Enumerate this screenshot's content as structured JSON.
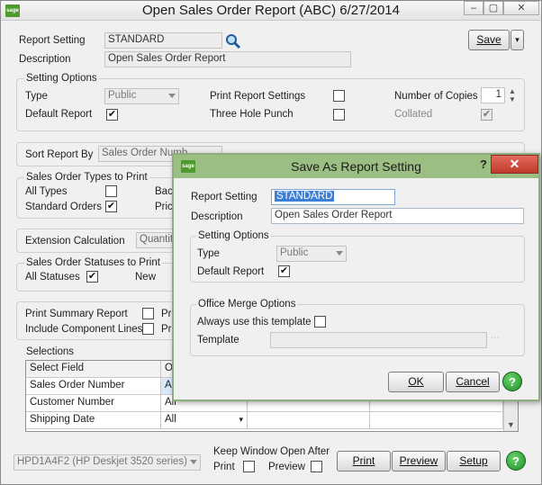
{
  "window": {
    "title": "Open Sales Order Report (ABC) 6/27/2014",
    "logo": "sage"
  },
  "main": {
    "report_setting_label": "Report Setting",
    "report_setting_value": "STANDARD",
    "description_label": "Description",
    "description_value": "Open Sales Order Report",
    "save_label": "Save",
    "setting_options": {
      "title": "Setting Options",
      "type_label": "Type",
      "type_value": "Public",
      "default_report_label": "Default Report",
      "default_report_checked": "✔",
      "print_report_settings_label": "Print Report Settings",
      "three_hole_punch_label": "Three Hole Punch",
      "copies_label": "Number of Copies",
      "copies_value": "1",
      "collated_label": "Collated",
      "collated_checked": "✔"
    },
    "sort_report_by_label": "Sort Report By",
    "sort_report_by_value": "Sales Order Numb",
    "sales_order_types": {
      "title": "Sales Order Types to Print",
      "all_types_label": "All Types",
      "standard_orders_label": "Standard Orders",
      "standard_orders_checked": "✔",
      "back_label": "Bac",
      "price_label": "Pric"
    },
    "extension_calc_label": "Extension Calculation",
    "extension_calc_value": "Quantity",
    "sales_order_statuses": {
      "title": "Sales Order Statuses to Print",
      "all_statuses_label": "All Statuses",
      "all_statuses_checked": "✔",
      "new_label": "New"
    },
    "print_summary_label": "Print Summary Report",
    "include_component_label": "Include Component Lines",
    "pri1_label": "Pri",
    "pri2_label": "Pri",
    "selections": {
      "title": "Selections",
      "header": [
        "Select Field",
        "O"
      ],
      "rows": [
        {
          "field": "Sales Order Number",
          "op": "Al"
        },
        {
          "field": "Customer Number",
          "op": "All"
        },
        {
          "field": "Shipping Date",
          "op": "All"
        }
      ]
    },
    "printer_value": "HPD1A4F2 (HP Deskjet 3520 series)",
    "keep_open_label": "Keep Window Open After",
    "print_chk_label": "Print",
    "preview_chk_label": "Preview",
    "print_button": "Print",
    "preview_button": "Preview",
    "setup_button": "Setup",
    "help_button": "?"
  },
  "dialog": {
    "title": "Save As Report Setting",
    "logo": "sage",
    "help_glyph": "?",
    "close_glyph": "✕",
    "report_setting_label": "Report Setting",
    "report_setting_value": "STANDARD",
    "description_label": "Description",
    "description_value": "Open Sales Order Report",
    "setting_options_title": "Setting Options",
    "type_label": "Type",
    "type_value": "Public",
    "default_report_label": "Default Report",
    "default_report_checked": "✔",
    "office_merge_title": "Office Merge Options",
    "always_use_label": "Always use this template",
    "template_label": "Template",
    "ok_button": "OK",
    "cancel_button": "Cancel",
    "help_button": "?"
  }
}
